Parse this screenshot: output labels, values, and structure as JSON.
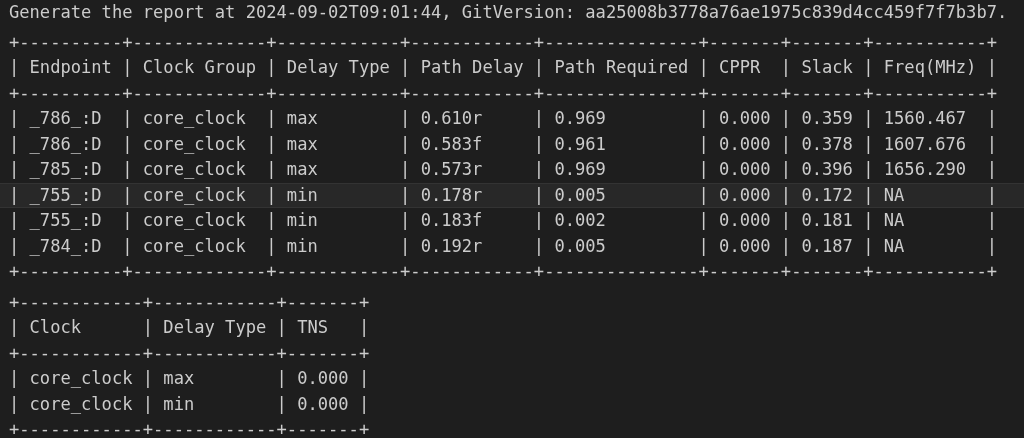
{
  "header": "Generate the report at 2024-09-02T09:01:44, GitVersion: aa25008b3778a76ae1975c839d4cc459f7f7b3b7.",
  "tables": [
    {
      "lines": [
        {
          "text": "+----------+-------------+------------+------------+---------------+-------+-------+-----------+",
          "highlighted": false
        },
        {
          "text": "| Endpoint | Clock Group | Delay Type | Path Delay | Path Required | CPPR  | Slack | Freq(MHz) |",
          "highlighted": false
        },
        {
          "text": "+----------+-------------+------------+------------+---------------+-------+-------+-----------+",
          "highlighted": false
        },
        {
          "text": "| _786_:D  | core_clock  | max        | 0.610r     | 0.969         | 0.000 | 0.359 | 1560.467  |",
          "highlighted": false
        },
        {
          "text": "| _786_:D  | core_clock  | max        | 0.583f     | 0.961         | 0.000 | 0.378 | 1607.676  |",
          "highlighted": false
        },
        {
          "text": "| _785_:D  | core_clock  | max        | 0.573r     | 0.969         | 0.000 | 0.396 | 1656.290  |",
          "highlighted": false
        },
        {
          "text": "| _755_:D  | core_clock  | min        | 0.178r     | 0.005         | 0.000 | 0.172 | NA        |",
          "highlighted": true
        },
        {
          "text": "| _755_:D  | core_clock  | min        | 0.183f     | 0.002         | 0.000 | 0.181 | NA        |",
          "highlighted": false
        },
        {
          "text": "| _784_:D  | core_clock  | min        | 0.192r     | 0.005         | 0.000 | 0.187 | NA        |",
          "highlighted": false
        },
        {
          "text": "+----------+-------------+------------+------------+---------------+-------+-------+-----------+",
          "highlighted": false
        }
      ]
    },
    {
      "lines": [
        {
          "text": "+------------+------------+-------+",
          "highlighted": false
        },
        {
          "text": "| Clock      | Delay Type | TNS   |",
          "highlighted": false
        },
        {
          "text": "+------------+------------+-------+",
          "highlighted": false
        },
        {
          "text": "| core_clock | max        | 0.000 |",
          "highlighted": false
        },
        {
          "text": "| core_clock | min        | 0.000 |",
          "highlighted": false
        },
        {
          "text": "+------------+------------+-------+",
          "highlighted": false
        }
      ]
    }
  ]
}
